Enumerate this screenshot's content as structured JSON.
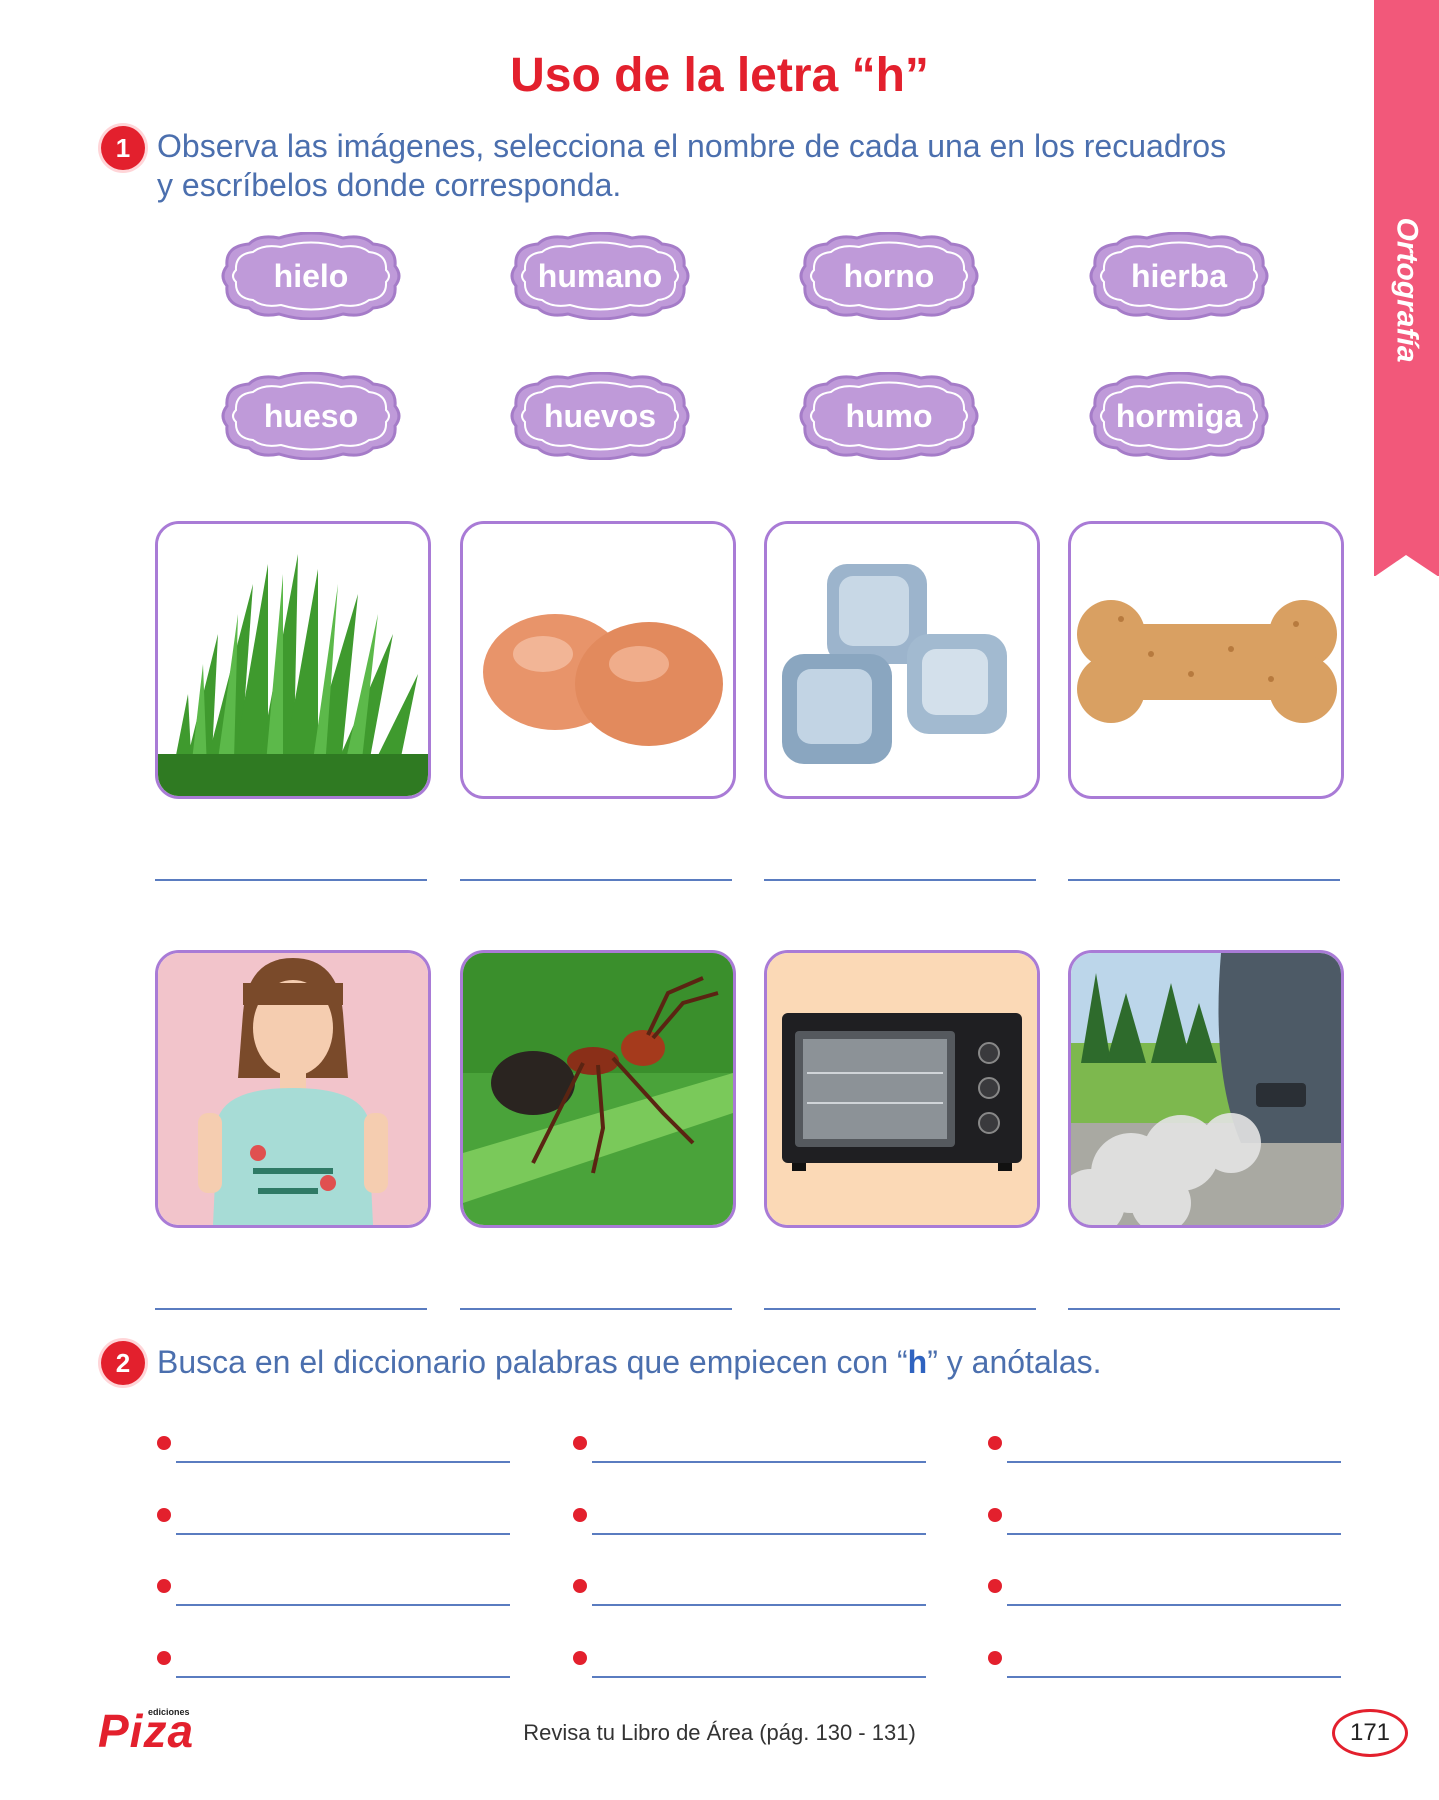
{
  "side_tab": {
    "label": "Ortografía",
    "color": "#f2587a"
  },
  "title": "Uso de la letra “h”",
  "exercise1": {
    "number": "1",
    "instruction_line1": "Observa las imágenes, selecciona el nombre de cada una en los recuadros",
    "instruction_line2": "y escríbelos donde corresponda.",
    "words": [
      "hielo",
      "humano",
      "horno",
      "hierba",
      "hueso",
      "huevos",
      "humo",
      "hormiga"
    ],
    "pictures": [
      "grass-image",
      "eggs-image",
      "ice-image",
      "bone-image",
      "girl-image",
      "ant-image",
      "oven-image",
      "smoke-image"
    ]
  },
  "exercise2": {
    "number": "2",
    "instruction_before": "Busca en el diccionario palabras que empiecen con “",
    "instruction_bold": "h",
    "instruction_after": "” y anótalas."
  },
  "footer": {
    "logo_text": "Piza",
    "logo_sub": "ediciones",
    "reference": "Revisa tu Libro de Área (pág. 130 - 131)",
    "page_number": "171"
  },
  "colors": {
    "accent_red": "#e3202d",
    "chip_purple": "#bf9ad9",
    "text_blue": "#4b6fae",
    "frame_purple": "#a97bd6"
  }
}
